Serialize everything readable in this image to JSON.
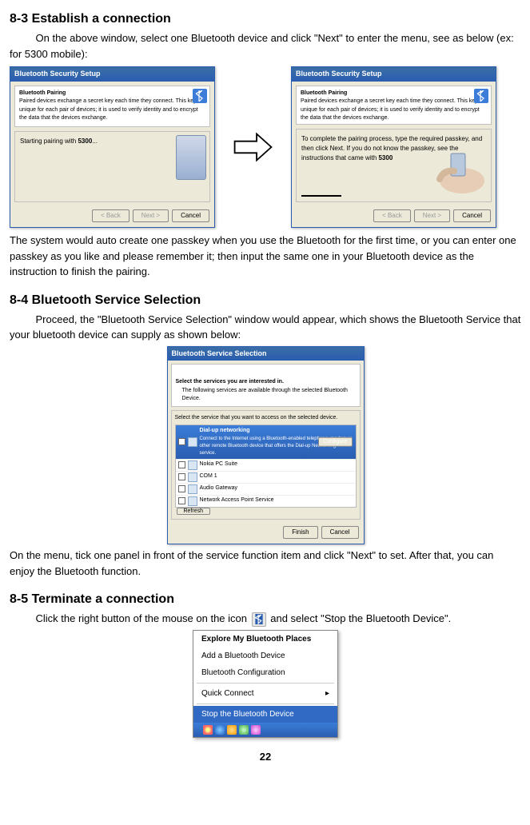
{
  "section83": {
    "heading": "8-3 Establish a connection",
    "para1": "On the above window, select one Bluetooth device and click \"Next\" to enter the menu, see as below (ex: for 5300 mobile):",
    "para2": "The system would auto create one passkey when you use the Bluetooth for the first time, or you can enter one passkey as you like and please remember it; then input the same one in your Bluetooth device as the instruction to finish the pairing."
  },
  "win1": {
    "title": "Bluetooth Security Setup",
    "pairing_title": "Bluetooth Pairing",
    "pairing_text": "Paired devices exchange a secret key each time they connect. This key is unique for each pair of devices; it is used to verify identity and to encrypt the data that the devices exchange.",
    "body_prefix": "Starting pairing with ",
    "body_bold": "5300",
    "body_suffix": "...",
    "back": "< Back",
    "next": "Next >",
    "cancel": "Cancel"
  },
  "win2": {
    "title": "Bluetooth Security Setup",
    "pairing_title": "Bluetooth Pairing",
    "pairing_text": "Paired devices exchange a secret key each time they connect. This key is unique for each pair of devices; it is used to verify identity and to encrypt the data that the devices exchange.",
    "body_line1": "To complete the pairing process, type the required passkey, and then click Next. If you do not know the passkey, see the instructions that came with ",
    "body_bold": "5300",
    "back": "< Back",
    "next": "Next >",
    "cancel": "Cancel"
  },
  "section84": {
    "heading": "8-4 Bluetooth Service Selection",
    "para1": "Proceed, the \"Bluetooth Service Selection\" window would appear, which shows the Bluetooth Service that your bluetooth device can supply as shown below:",
    "para2": "On the menu, tick one panel in front of the service function item and click \"Next\" to set. After that, you can enjoy the Bluetooth function."
  },
  "svc": {
    "title": "Bluetooth Service Selection",
    "head_bold": "Select the services you are interested in.",
    "head_sub": "The following services are available through the selected Bluetooth Device.",
    "instruction": "Select the service that you want to access on the selected device.",
    "sel_title": "Dial-up networking",
    "sel_desc": "Connect to the Internet using a Bluetooth-enabled telephone, modem or other remote Bluetooth device that offers the Dial-up Networking service.",
    "configure": "Configure",
    "items": [
      "Nokia PC Suite",
      "COM 1",
      "Audio Gateway",
      "Network Access Point Service"
    ],
    "refresh": "Refresh",
    "finish": "Finish",
    "cancel": "Cancel"
  },
  "section85": {
    "heading": "8-5 Terminate a connection",
    "text_before": "Click the right button of the mouse on the icon ",
    "text_after": " and select \"Stop the Bluetooth Device\"."
  },
  "menu": {
    "items": [
      "Explore My Bluetooth Places",
      "Add a Bluetooth Device",
      "Bluetooth Configuration"
    ],
    "quick": "Quick Connect",
    "stop": "Stop the Bluetooth Device"
  },
  "page_number": "22"
}
